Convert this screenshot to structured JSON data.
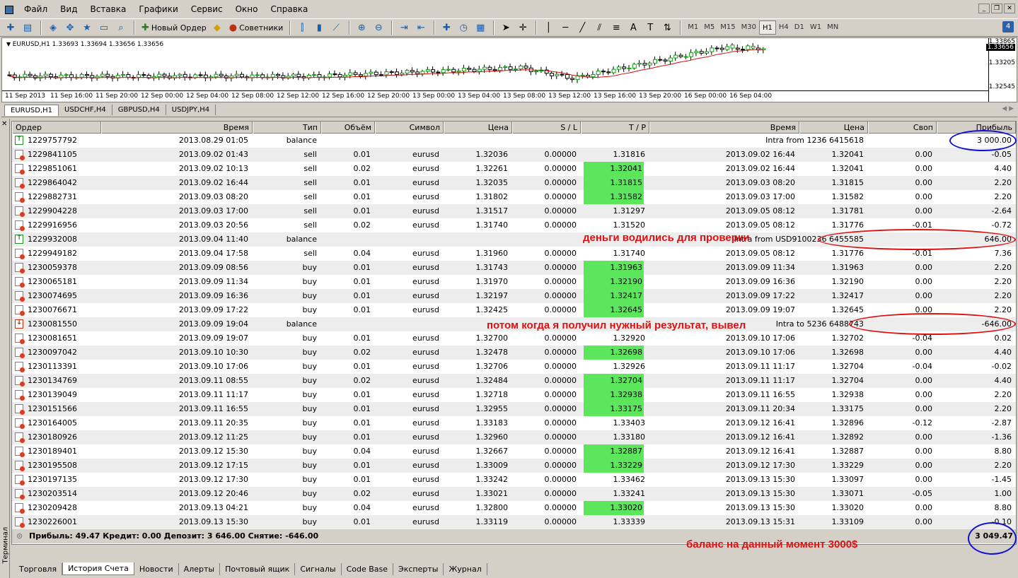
{
  "menu": [
    "Файл",
    "Вид",
    "Вставка",
    "Графики",
    "Сервис",
    "Окно",
    "Справка"
  ],
  "toolbar": {
    "new_order": "Новый Ордер",
    "advisors": "Советники",
    "timeframes": [
      "M1",
      "M5",
      "M15",
      "M30",
      "H1",
      "H4",
      "D1",
      "W1",
      "MN"
    ],
    "active_timeframe": "H1",
    "badge": "4"
  },
  "chart": {
    "title": "EURUSD,H1  1.33693 1.33694 1.33656 1.33656",
    "prices": [
      "1.33865",
      "1.33656",
      "1.33205",
      "1.32545"
    ],
    "times": [
      "11 Sep 2013",
      "11 Sep 16:00",
      "11 Sep 20:00",
      "12 Sep 00:00",
      "12 Sep 04:00",
      "12 Sep 08:00",
      "12 Sep 12:00",
      "12 Sep 16:00",
      "12 Sep 20:00",
      "13 Sep 00:00",
      "13 Sep 04:00",
      "13 Sep 08:00",
      "13 Sep 12:00",
      "13 Sep 16:00",
      "13 Sep 20:00",
      "16 Sep 00:00",
      "16 Sep 04:00"
    ]
  },
  "chart_tabs": [
    "EURUSD,H1",
    "USDCHF,H4",
    "GBPUSD,H4",
    "USDJPY,H4"
  ],
  "columns": [
    "Ордер",
    "Время",
    "Тип",
    "Объём",
    "Символ",
    "Цена",
    "S / L",
    "T / P",
    "Время",
    "Цена",
    "Своп",
    "Прибыль"
  ],
  "rows": [
    {
      "icon": "bal-in",
      "order": "1229757792",
      "time": "2013.08.29 01:05",
      "type": "balance",
      "vol": "",
      "sym": "",
      "price": "",
      "sl": "",
      "tp": "",
      "ctime": "",
      "cprice": "Intra from 1236 6415618",
      "swap": "",
      "profit": "3 000.00",
      "tphl": false
    },
    {
      "icon": "sell",
      "order": "1229841105",
      "time": "2013.09.02 01:43",
      "type": "sell",
      "vol": "0.01",
      "sym": "eurusd",
      "price": "1.32036",
      "sl": "0.00000",
      "tp": "1.31816",
      "ctime": "2013.09.02 16:44",
      "cprice": "1.32041",
      "swap": "0.00",
      "profit": "-0.05",
      "tphl": false
    },
    {
      "icon": "sell",
      "order": "1229851061",
      "time": "2013.09.02 10:13",
      "type": "sell",
      "vol": "0.02",
      "sym": "eurusd",
      "price": "1.32261",
      "sl": "0.00000",
      "tp": "1.32041",
      "ctime": "2013.09.02 16:44",
      "cprice": "1.32041",
      "swap": "0.00",
      "profit": "4.40",
      "tphl": true
    },
    {
      "icon": "sell",
      "order": "1229864042",
      "time": "2013.09.02 16:44",
      "type": "sell",
      "vol": "0.01",
      "sym": "eurusd",
      "price": "1.32035",
      "sl": "0.00000",
      "tp": "1.31815",
      "ctime": "2013.09.03 08:20",
      "cprice": "1.31815",
      "swap": "0.00",
      "profit": "2.20",
      "tphl": true
    },
    {
      "icon": "sell",
      "order": "1229882731",
      "time": "2013.09.03 08:20",
      "type": "sell",
      "vol": "0.01",
      "sym": "eurusd",
      "price": "1.31802",
      "sl": "0.00000",
      "tp": "1.31582",
      "ctime": "2013.09.03 17:00",
      "cprice": "1.31582",
      "swap": "0.00",
      "profit": "2.20",
      "tphl": true
    },
    {
      "icon": "sell",
      "order": "1229904228",
      "time": "2013.09.03 17:00",
      "type": "sell",
      "vol": "0.01",
      "sym": "eurusd",
      "price": "1.31517",
      "sl": "0.00000",
      "tp": "1.31297",
      "ctime": "2013.09.05 08:12",
      "cprice": "1.31781",
      "swap": "0.00",
      "profit": "-2.64",
      "tphl": false
    },
    {
      "icon": "sell",
      "order": "1229916956",
      "time": "2013.09.03 20:56",
      "type": "sell",
      "vol": "0.02",
      "sym": "eurusd",
      "price": "1.31740",
      "sl": "0.00000",
      "tp": "1.31520",
      "ctime": "2013.09.05 08:12",
      "cprice": "1.31776",
      "swap": "-0.01",
      "profit": "-0.72",
      "tphl": false
    },
    {
      "icon": "bal-in",
      "order": "1229932008",
      "time": "2013.09.04 11:40",
      "type": "balance",
      "vol": "",
      "sym": "",
      "price": "",
      "sl": "",
      "tp": "",
      "ctime": "",
      "cprice": "Intra from USD9100236 6455585",
      "swap": "",
      "profit": "646.00",
      "tphl": false
    },
    {
      "icon": "sell",
      "order": "1229949182",
      "time": "2013.09.04 17:58",
      "type": "sell",
      "vol": "0.04",
      "sym": "eurusd",
      "price": "1.31960",
      "sl": "0.00000",
      "tp": "1.31740",
      "ctime": "2013.09.05 08:12",
      "cprice": "1.31776",
      "swap": "-0.01",
      "profit": "7.36",
      "tphl": false
    },
    {
      "icon": "buy",
      "order": "1230059378",
      "time": "2013.09.09 08:56",
      "type": "buy",
      "vol": "0.01",
      "sym": "eurusd",
      "price": "1.31743",
      "sl": "0.00000",
      "tp": "1.31963",
      "ctime": "2013.09.09 11:34",
      "cprice": "1.31963",
      "swap": "0.00",
      "profit": "2.20",
      "tphl": true
    },
    {
      "icon": "buy",
      "order": "1230065181",
      "time": "2013.09.09 11:34",
      "type": "buy",
      "vol": "0.01",
      "sym": "eurusd",
      "price": "1.31970",
      "sl": "0.00000",
      "tp": "1.32190",
      "ctime": "2013.09.09 16:36",
      "cprice": "1.32190",
      "swap": "0.00",
      "profit": "2.20",
      "tphl": true
    },
    {
      "icon": "buy",
      "order": "1230074695",
      "time": "2013.09.09 16:36",
      "type": "buy",
      "vol": "0.01",
      "sym": "eurusd",
      "price": "1.32197",
      "sl": "0.00000",
      "tp": "1.32417",
      "ctime": "2013.09.09 17:22",
      "cprice": "1.32417",
      "swap": "0.00",
      "profit": "2.20",
      "tphl": true
    },
    {
      "icon": "buy",
      "order": "1230076671",
      "time": "2013.09.09 17:22",
      "type": "buy",
      "vol": "0.01",
      "sym": "eurusd",
      "price": "1.32425",
      "sl": "0.00000",
      "tp": "1.32645",
      "ctime": "2013.09.09 19:07",
      "cprice": "1.32645",
      "swap": "0.00",
      "profit": "2.20",
      "tphl": true
    },
    {
      "icon": "bal-out",
      "order": "1230081550",
      "time": "2013.09.09 19:04",
      "type": "balance",
      "vol": "",
      "sym": "",
      "price": "",
      "sl": "",
      "tp": "",
      "ctime": "",
      "cprice": "Intra to 5236 6488743",
      "swap": "",
      "profit": "-646.00",
      "tphl": false
    },
    {
      "icon": "buy",
      "order": "1230081651",
      "time": "2013.09.09 19:07",
      "type": "buy",
      "vol": "0.01",
      "sym": "eurusd",
      "price": "1.32700",
      "sl": "0.00000",
      "tp": "1.32920",
      "ctime": "2013.09.10 17:06",
      "cprice": "1.32702",
      "swap": "-0.04",
      "profit": "0.02",
      "tphl": false
    },
    {
      "icon": "buy",
      "order": "1230097042",
      "time": "2013.09.10 10:30",
      "type": "buy",
      "vol": "0.02",
      "sym": "eurusd",
      "price": "1.32478",
      "sl": "0.00000",
      "tp": "1.32698",
      "ctime": "2013.09.10 17:06",
      "cprice": "1.32698",
      "swap": "0.00",
      "profit": "4.40",
      "tphl": true
    },
    {
      "icon": "buy",
      "order": "1230113391",
      "time": "2013.09.10 17:06",
      "type": "buy",
      "vol": "0.01",
      "sym": "eurusd",
      "price": "1.32706",
      "sl": "0.00000",
      "tp": "1.32926",
      "ctime": "2013.09.11 11:17",
      "cprice": "1.32704",
      "swap": "-0.04",
      "profit": "-0.02",
      "tphl": false
    },
    {
      "icon": "buy",
      "order": "1230134769",
      "time": "2013.09.11 08:55",
      "type": "buy",
      "vol": "0.02",
      "sym": "eurusd",
      "price": "1.32484",
      "sl": "0.00000",
      "tp": "1.32704",
      "ctime": "2013.09.11 11:17",
      "cprice": "1.32704",
      "swap": "0.00",
      "profit": "4.40",
      "tphl": true
    },
    {
      "icon": "buy",
      "order": "1230139049",
      "time": "2013.09.11 11:17",
      "type": "buy",
      "vol": "0.01",
      "sym": "eurusd",
      "price": "1.32718",
      "sl": "0.00000",
      "tp": "1.32938",
      "ctime": "2013.09.11 16:55",
      "cprice": "1.32938",
      "swap": "0.00",
      "profit": "2.20",
      "tphl": true
    },
    {
      "icon": "buy",
      "order": "1230151566",
      "time": "2013.09.11 16:55",
      "type": "buy",
      "vol": "0.01",
      "sym": "eurusd",
      "price": "1.32955",
      "sl": "0.00000",
      "tp": "1.33175",
      "ctime": "2013.09.11 20:34",
      "cprice": "1.33175",
      "swap": "0.00",
      "profit": "2.20",
      "tphl": true
    },
    {
      "icon": "buy",
      "order": "1230164005",
      "time": "2013.09.11 20:35",
      "type": "buy",
      "vol": "0.01",
      "sym": "eurusd",
      "price": "1.33183",
      "sl": "0.00000",
      "tp": "1.33403",
      "ctime": "2013.09.12 16:41",
      "cprice": "1.32896",
      "swap": "-0.12",
      "profit": "-2.87",
      "tphl": false
    },
    {
      "icon": "buy",
      "order": "1230180926",
      "time": "2013.09.12 11:25",
      "type": "buy",
      "vol": "0.01",
      "sym": "eurusd",
      "price": "1.32960",
      "sl": "0.00000",
      "tp": "1.33180",
      "ctime": "2013.09.12 16:41",
      "cprice": "1.32892",
      "swap": "0.00",
      "profit": "-1.36",
      "tphl": false
    },
    {
      "icon": "buy",
      "order": "1230189401",
      "time": "2013.09.12 15:30",
      "type": "buy",
      "vol": "0.04",
      "sym": "eurusd",
      "price": "1.32667",
      "sl": "0.00000",
      "tp": "1.32887",
      "ctime": "2013.09.12 16:41",
      "cprice": "1.32887",
      "swap": "0.00",
      "profit": "8.80",
      "tphl": true
    },
    {
      "icon": "buy",
      "order": "1230195508",
      "time": "2013.09.12 17:15",
      "type": "buy",
      "vol": "0.01",
      "sym": "eurusd",
      "price": "1.33009",
      "sl": "0.00000",
      "tp": "1.33229",
      "ctime": "2013.09.12 17:30",
      "cprice": "1.33229",
      "swap": "0.00",
      "profit": "2.20",
      "tphl": true
    },
    {
      "icon": "buy",
      "order": "1230197135",
      "time": "2013.09.12 17:30",
      "type": "buy",
      "vol": "0.01",
      "sym": "eurusd",
      "price": "1.33242",
      "sl": "0.00000",
      "tp": "1.33462",
      "ctime": "2013.09.13 15:30",
      "cprice": "1.33097",
      "swap": "0.00",
      "profit": "-1.45",
      "tphl": false
    },
    {
      "icon": "buy",
      "order": "1230203514",
      "time": "2013.09.12 20:46",
      "type": "buy",
      "vol": "0.02",
      "sym": "eurusd",
      "price": "1.33021",
      "sl": "0.00000",
      "tp": "1.33241",
      "ctime": "2013.09.13 15:30",
      "cprice": "1.33071",
      "swap": "-0.05",
      "profit": "1.00",
      "tphl": false
    },
    {
      "icon": "buy",
      "order": "1230209428",
      "time": "2013.09.13 04:21",
      "type": "buy",
      "vol": "0.04",
      "sym": "eurusd",
      "price": "1.32800",
      "sl": "0.00000",
      "tp": "1.33020",
      "ctime": "2013.09.13 15:30",
      "cprice": "1.33020",
      "swap": "0.00",
      "profit": "8.80",
      "tphl": true
    },
    {
      "icon": "buy",
      "order": "1230226001",
      "time": "2013.09.13 15:30",
      "type": "buy",
      "vol": "0.01",
      "sym": "eurusd",
      "price": "1.33119",
      "sl": "0.00000",
      "tp": "1.33339",
      "ctime": "2013.09.13 15:31",
      "cprice": "1.33109",
      "swap": "0.00",
      "profit": "-0.10",
      "tphl": false
    }
  ],
  "summary": {
    "text": "Прибыль: 49.47  Кредит: 0.00  Депозит: 3 646.00  Снятие: -646.00",
    "total": "3 049.47"
  },
  "annotations": {
    "a1": "деньги водились  для проверки",
    "a2": "потом  когда я получил нужный результат,  вывел",
    "a3": "баланс на данный момент 3000$"
  },
  "bottom_tabs": [
    "Торговля",
    "История Счета",
    "Новости",
    "Алерты",
    "Почтовый ящик",
    "Сигналы",
    "Code Base",
    "Эксперты",
    "Журнал"
  ],
  "active_bottom_tab": "История Счета",
  "terminal_label": "Терминал",
  "colors": {
    "tp_highlight": "#5ce65c",
    "annotation": "#e01010",
    "ellipse_blue": "#1010d0",
    "ellipse_red": "#e01010"
  }
}
